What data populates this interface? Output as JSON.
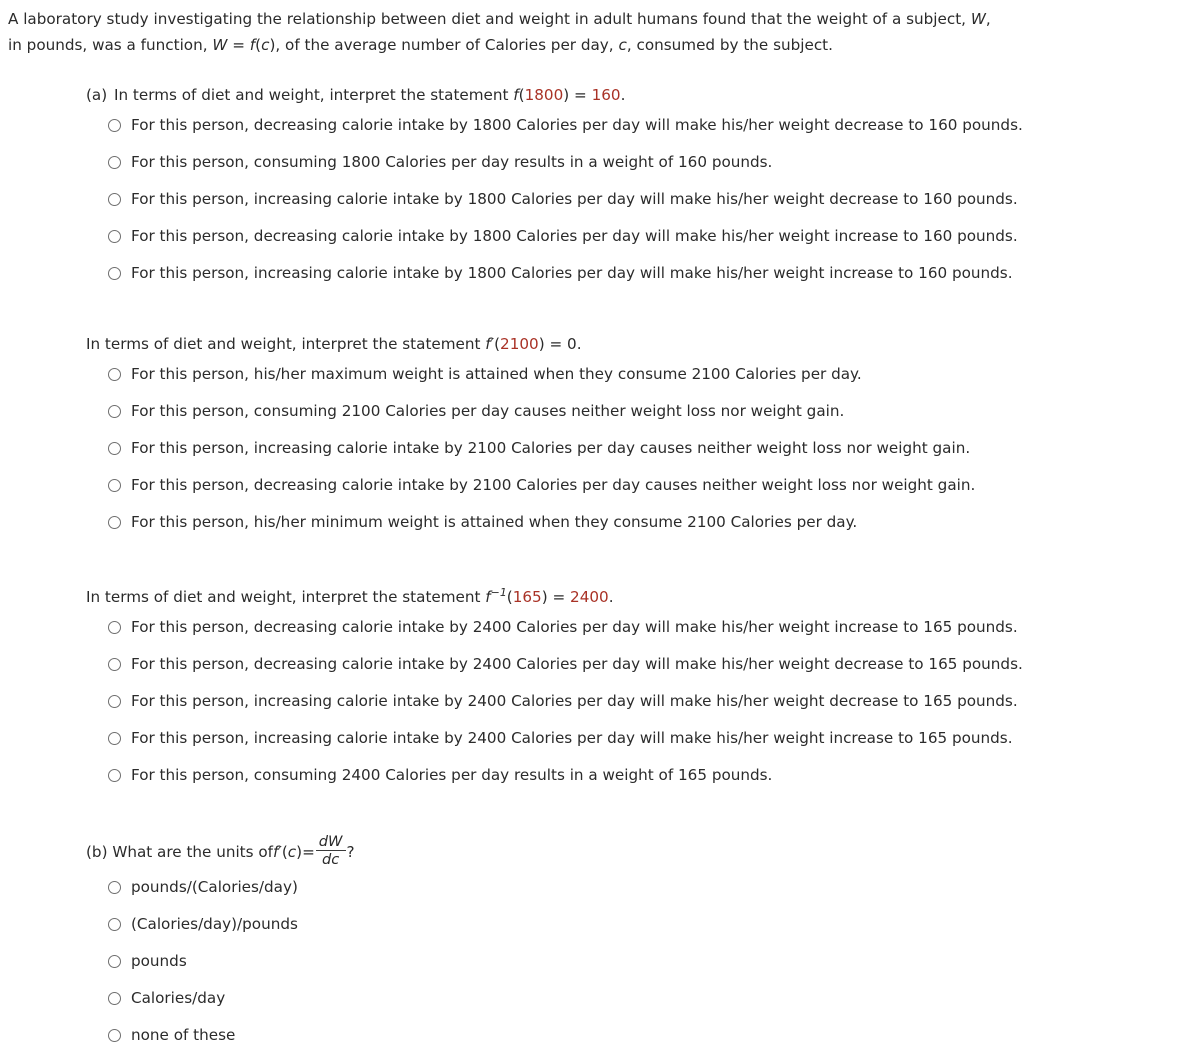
{
  "intro": {
    "line1_a": "A laboratory study investigating the relationship between diet and weight in adult humans found that the weight of a subject, ",
    "line1_var": "W",
    "line1_b": ",",
    "line2_a": "in pounds, was a function,  ",
    "line2_w": "W",
    "line2_eq": " = ",
    "line2_f": "f",
    "line2_paren_open": "(",
    "line2_c": "c",
    "line2_paren_close": "),",
    "line2_b": "  of the average number of Calories per day, ",
    "line2_c2": "c",
    "line2_end": ", consumed by the subject."
  },
  "part_a": {
    "label": "(a)",
    "prompt_before": "In terms of diet and weight, interpret the statement ",
    "f": "f",
    "paren_open": "(",
    "arg": "1800",
    "paren_close": ")",
    "equals": " = ",
    "value": "160",
    "period": ".",
    "options": [
      "For this person, decreasing calorie intake by 1800 Calories per day will make his/her weight decrease to 160 pounds.",
      "For this person, consuming 1800 Calories per day results in a weight of 160 pounds.",
      "For this person, increasing calorie intake by 1800 Calories per day will make his/her weight decrease to 160 pounds.",
      "For this person, decreasing calorie intake by 1800 Calories per day will make his/her weight increase to 160 pounds.",
      "For this person, increasing calorie intake by 1800 Calories per day will make his/her weight increase to 160 pounds."
    ]
  },
  "part_a2": {
    "prompt_before": "In terms of diet and weight, interpret the statement ",
    "f": "f",
    "prime": "′",
    "paren_open": "(",
    "arg": "2100",
    "paren_close": ")",
    "equals": " = ",
    "value": "0",
    "period": ".",
    "options": [
      "For this person, his/her maximum weight is attained when they consume 2100 Calories per day.",
      "For this person, consuming 2100 Calories per day causes neither weight loss nor weight gain.",
      "For this person, increasing calorie intake by 2100 Calories per day causes neither weight loss nor weight gain.",
      "For this person, decreasing calorie intake by 2100 Calories per day causes neither weight loss nor weight gain.",
      "For this person, his/her minimum weight is attained when they consume 2100 Calories per day."
    ]
  },
  "part_a3": {
    "prompt_before": "In terms of diet and weight, interpret the statement ",
    "f": "f",
    "exponent": "−1",
    "paren_open": "(",
    "arg": "165",
    "paren_close": ")",
    "equals": " = ",
    "value": "2400",
    "period": ".",
    "options": [
      "For this person, decreasing calorie intake by 2400 Calories per day will make his/her weight increase to 165 pounds.",
      "For this person, decreasing calorie intake by 2400 Calories per day will make his/her weight decrease to 165 pounds.",
      "For this person, increasing calorie intake by 2400 Calories per day will make his/her weight decrease to 165 pounds.",
      "For this person, increasing calorie intake by 2400 Calories per day will make his/her weight increase to 165 pounds.",
      "For this person, consuming 2400 Calories per day results in a weight of 165 pounds."
    ]
  },
  "part_b": {
    "label": "(b)",
    "prompt_before": "What are the units of ",
    "f": "f",
    "prime": "′",
    "paren_open": "(",
    "c": "c",
    "paren_close": ")",
    "equals": " = ",
    "frac_num": "dW",
    "frac_den": "dc",
    "question_mark": "?",
    "options": [
      "pounds/(Calories/day)",
      "(Calories/day)/pounds",
      "pounds",
      "Calories/day",
      "none of these"
    ]
  },
  "colors": {
    "text": "#2b2b2b",
    "accent_red": "#a93226",
    "radio_border": "#6f6f6f",
    "background": "#ffffff"
  }
}
